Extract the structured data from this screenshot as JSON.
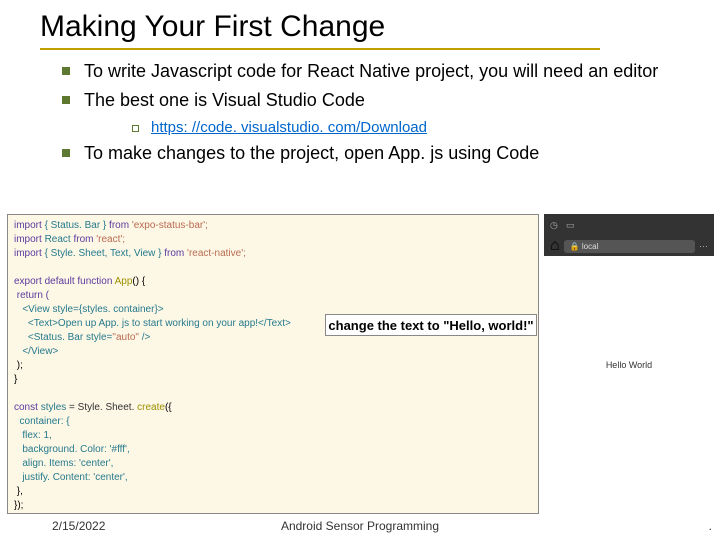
{
  "title": "Making Your First Change",
  "bullets": {
    "b1": "To write Javascript code for React Native project, you will need an editor",
    "b2": "The best one is Visual Studio Code",
    "sub1": "https: //code. visualstudio. com/Download",
    "b3": "To make changes to the project, open App. js using Code"
  },
  "code": {
    "line1_a": "import ",
    "line1_b": "{ Status. Bar } ",
    "line1_c": "from ",
    "line1_d": "'expo-status-bar';",
    "line2_a": "import ",
    "line2_b": "React ",
    "line2_c": "from ",
    "line2_d": "'react';",
    "line3_a": "import ",
    "line3_b": "{ Style. Sheet, Text, View } ",
    "line3_c": "from ",
    "line3_d": "'react-native';",
    "line5_a": "export default function ",
    "line5_b": "App",
    "line5_c": "() {",
    "line6": " return (",
    "line7": "   <View style={styles. container}>",
    "line8": "     <Text>Open up App. js to start working on your app!</Text>",
    "line9_a": "     <Status. Bar ",
    "line9_b": "style=",
    "line9_c": "\"auto\" ",
    "line9_d": "/>",
    "line10": "   </View>",
    "line11": " );",
    "line12": "}",
    "line14_a": "const ",
    "line14_b": "styles ",
    "line14_c": "= Style. Sheet. ",
    "line14_d": "create",
    "line14_e": "({",
    "line15": "  container: {",
    "line16": "   flex: 1,",
    "line17": "   background. Color: '#fff',",
    "line18": "   align. Items: 'center',",
    "line19": "   justify. Content: 'center',",
    "line20": " },",
    "line21": "});"
  },
  "instruction": "change the text to \"Hello, world!\"",
  "phone": {
    "url": "local",
    "body": "Hello World"
  },
  "footer": {
    "date": "2/15/2022",
    "center": "Android Sensor Programming",
    "page": "."
  }
}
